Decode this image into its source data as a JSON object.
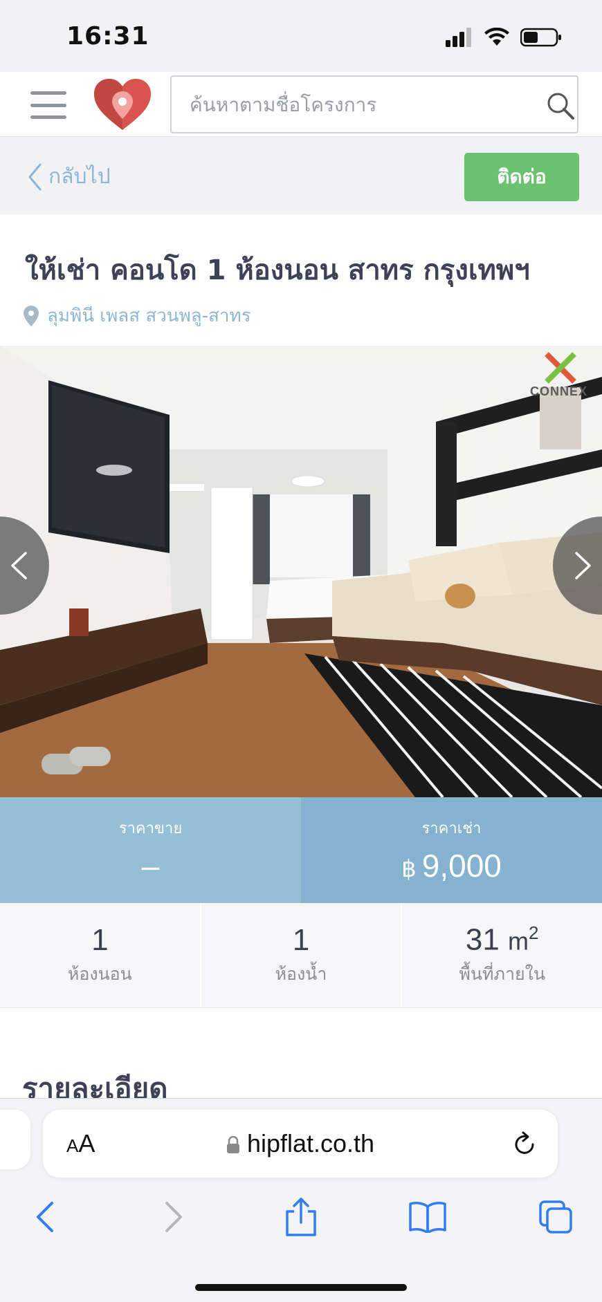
{
  "status_bar": {
    "time": "16:31"
  },
  "header": {
    "search_placeholder": "ค้นหาตามชื่อโครงการ"
  },
  "sub_header": {
    "back_label": "กลับไป",
    "contact_label": "ติดต่อ"
  },
  "listing": {
    "title": "ให้เช่า คอนโด 1 ห้องนอน สาทร กรุงเทพฯ",
    "location": "ลุมพินี เพลส สวนพลู-สาทร",
    "watermark": "CONNEX"
  },
  "prices": {
    "sale_label": "ราคาขาย",
    "sale_value": "–",
    "rent_label": "ราคาเช่า",
    "rent_currency": "฿",
    "rent_value": "9,000"
  },
  "specs": [
    {
      "value": "1",
      "label": "ห้องนอน"
    },
    {
      "value": "1",
      "label": "ห้องน้ำ"
    },
    {
      "value": "31",
      "unit": "m",
      "unit_sup": "2",
      "label": "พื้นที่ภายใน"
    }
  ],
  "details": {
    "heading": "รายละเอียด"
  },
  "browser": {
    "aa_small": "A",
    "aa_big": "A",
    "url": "hipflat.co.th"
  },
  "colors": {
    "contact_button": "#6cc171",
    "sale_price_bg": "#95bfd6",
    "rent_price_bg": "#84b2cf",
    "link": "#8cb6d6",
    "ios_blue": "#2f7cf6"
  }
}
